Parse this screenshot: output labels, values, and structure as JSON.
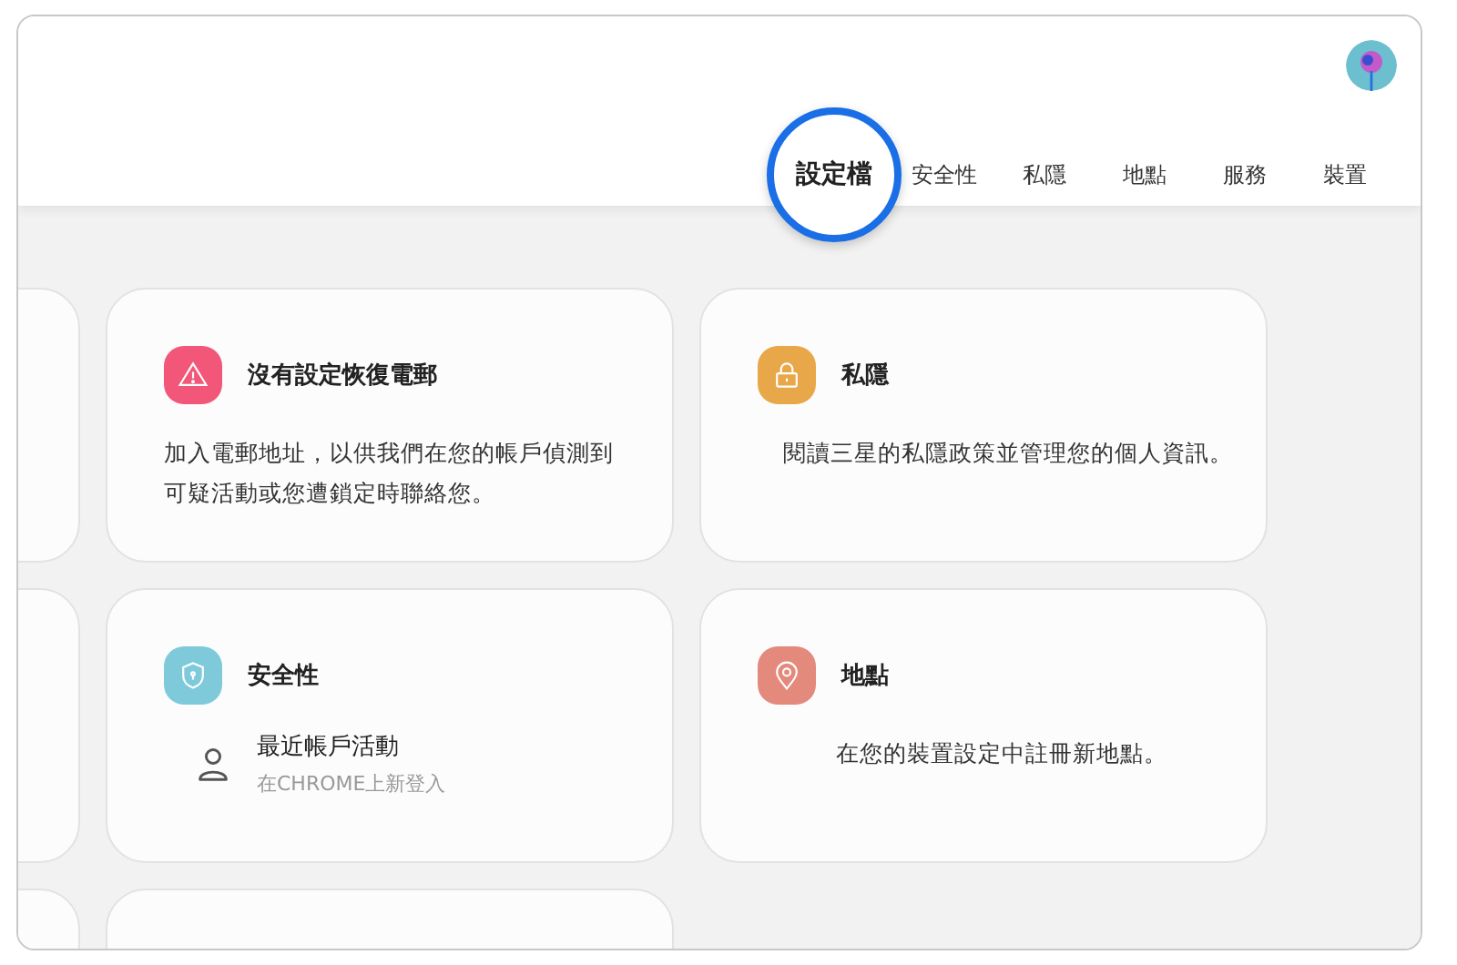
{
  "tabs": [
    {
      "label": "設定檔",
      "selected": true
    },
    {
      "label": "安全性",
      "selected": false
    },
    {
      "label": "私隱",
      "selected": false
    },
    {
      "label": "地點",
      "selected": false
    },
    {
      "label": "服務",
      "selected": false
    },
    {
      "label": "裝置",
      "selected": false
    }
  ],
  "cards": [
    {
      "kind": "alert",
      "color": "#f2577a",
      "title": "沒有設定恢復電郵",
      "body": "加入電郵地址，以供我們在您的帳戶偵測到可疑活動或您遭鎖定時聯絡您。"
    },
    {
      "kind": "privacy",
      "color": "#e8a84a",
      "title": "私隱",
      "body": "閱讀三星的私隱政策並管理您的個人資訊。"
    },
    {
      "kind": "security",
      "color": "#7ecadb",
      "title": "安全性",
      "activity": {
        "title": "最近帳戶活動",
        "subtitle": "在CHROME上新登入"
      }
    },
    {
      "kind": "location",
      "color": "#e38a7c",
      "title": "地點",
      "body": "在您的裝置設定中註冊新地點。"
    }
  ]
}
